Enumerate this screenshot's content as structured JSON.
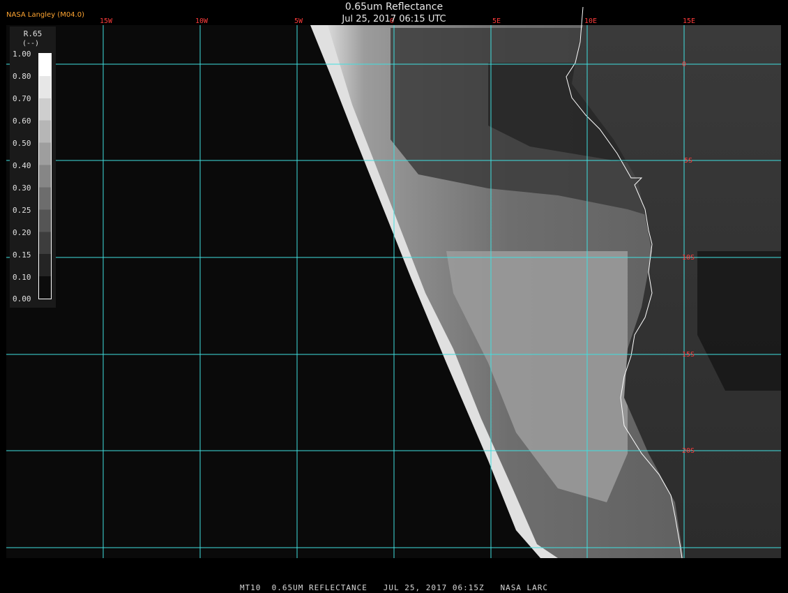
{
  "header": {
    "title": "0.65um Reflectance",
    "datetime": "Jul 25, 2017 06:15 UTC",
    "brand": "NASA Langley (M04.0)"
  },
  "legend": {
    "title": "R.65",
    "units": "(--)",
    "ticks": [
      "1.00",
      "0.80",
      "0.70",
      "0.60",
      "0.50",
      "0.40",
      "0.30",
      "0.25",
      "0.20",
      "0.15",
      "0.10",
      "0.00"
    ]
  },
  "map": {
    "longitude_labels": [
      "15W",
      "10W",
      "5W",
      "0",
      "5E",
      "10E",
      "15E"
    ],
    "latitude_labels": [
      "0",
      "5S",
      "10S",
      "15S",
      "20S"
    ]
  },
  "footer": {
    "text": "MT10  0.65UM REFLECTANCE   JUL 25, 2017 06:15Z   NASA LARC"
  },
  "colors": {
    "grid": "#40e0e0",
    "grid_labels": "#ff3b3b",
    "brand": "#ffa531",
    "coastline": "#ffffff"
  }
}
